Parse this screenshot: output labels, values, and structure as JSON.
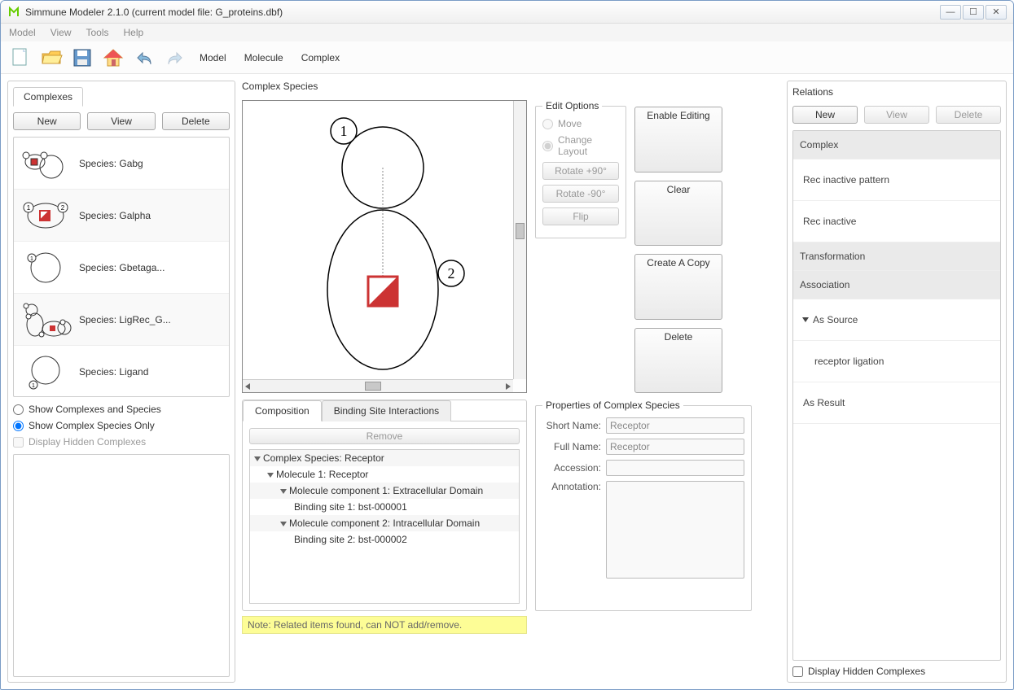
{
  "window": {
    "title": "Simmune Modeler  2.1.0 (current model file: G_proteins.dbf)"
  },
  "menubar": [
    "Model",
    "View",
    "Tools",
    "Help"
  ],
  "toolbar_text": [
    "Model",
    "Molecule",
    "Complex"
  ],
  "complexes": {
    "tab_label": "Complexes",
    "buttons": {
      "new": "New",
      "view": "View",
      "delete": "Delete"
    },
    "items": [
      {
        "label": "Species: Gabg"
      },
      {
        "label": "Species: Galpha"
      },
      {
        "label": "Species: Gbetaga..."
      },
      {
        "label": "Species: LigRec_G..."
      },
      {
        "label": "Species: Ligand"
      }
    ],
    "radios": {
      "all": "Show Complexes and Species",
      "species_only": "Show Complex Species Only",
      "hidden": "Display Hidden Complexes"
    }
  },
  "center": {
    "heading": "Complex Species",
    "edit_options": {
      "legend": "Edit Options",
      "move": "Move",
      "change_layout": "Change Layout",
      "rotate_p90": "Rotate +90°",
      "rotate_m90": "Rotate -90°",
      "flip": "Flip"
    },
    "actions": {
      "enable": "Enable Editing",
      "clear": "Clear",
      "copy": "Create A Copy",
      "delete": "Delete"
    },
    "tabs": {
      "composition": "Composition",
      "binding": "Binding Site Interactions"
    },
    "remove": "Remove",
    "tree": [
      "Complex Species: Receptor",
      "Molecule 1: Receptor",
      "Molecule component 1: Extracellular Domain",
      "Binding site 1: bst-000001",
      "Molecule component 2: Intracellular Domain",
      "Binding site 2: bst-000002"
    ],
    "note": "Note: Related items found, can NOT add/remove."
  },
  "properties": {
    "legend": "Properties of Complex Species",
    "labels": {
      "short": "Short Name:",
      "full": "Full Name:",
      "accession": "Accession:",
      "annotation": "Annotation:"
    },
    "values": {
      "short": "Receptor",
      "full": "Receptor",
      "accession": "",
      "annotation": ""
    }
  },
  "relations": {
    "heading": "Relations",
    "buttons": {
      "new": "New",
      "view": "View",
      "delete": "Delete"
    },
    "items": [
      {
        "type": "heading",
        "text": "Complex"
      },
      {
        "type": "item",
        "text": "Rec inactive pattern"
      },
      {
        "type": "item",
        "text": "Rec inactive"
      },
      {
        "type": "heading",
        "text": "Transformation"
      },
      {
        "type": "heading",
        "text": "Association"
      },
      {
        "type": "expand",
        "text": "As Source"
      },
      {
        "type": "sub",
        "text": "receptor ligation"
      },
      {
        "type": "item",
        "text": "As Result"
      }
    ],
    "checkbox": "Display Hidden Complexes"
  }
}
